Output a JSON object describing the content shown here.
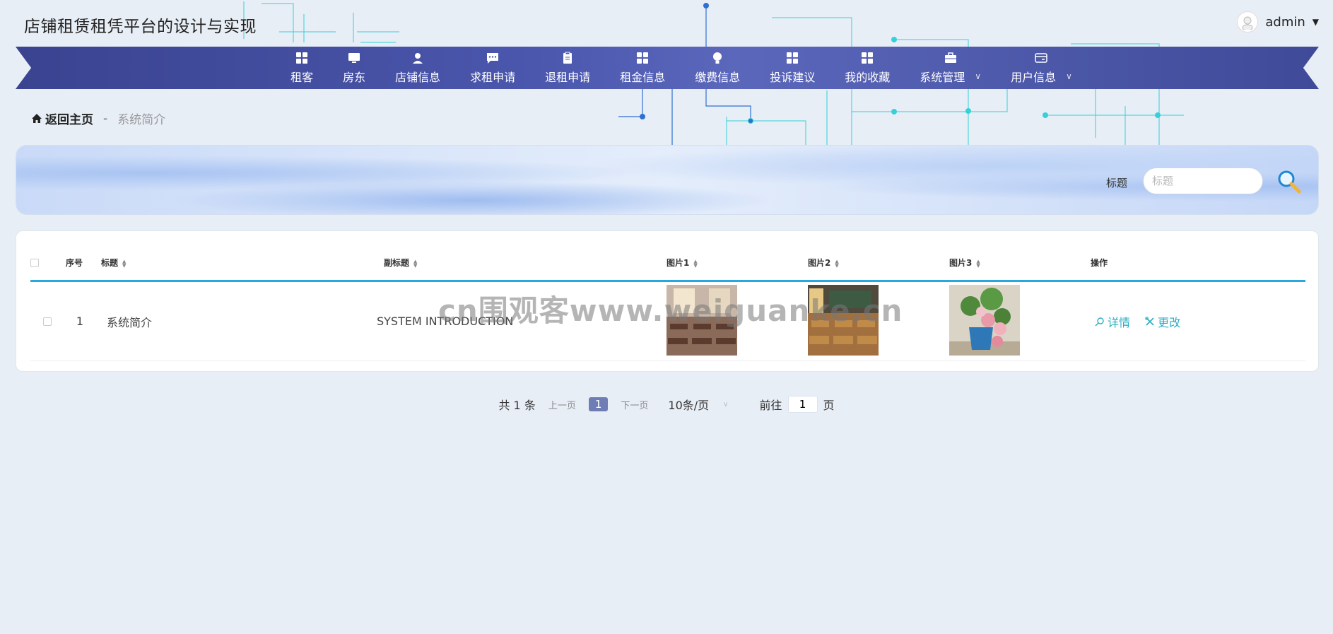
{
  "app": {
    "title": "店铺租赁租凭平台的设计与实现"
  },
  "user": {
    "name": "admin"
  },
  "nav": {
    "items": [
      {
        "label": "租客",
        "icon": "grid-icon"
      },
      {
        "label": "房东",
        "icon": "monitor-icon"
      },
      {
        "label": "店铺信息",
        "icon": "user-icon"
      },
      {
        "label": "求租申请",
        "icon": "chat-icon"
      },
      {
        "label": "退租申请",
        "icon": "clipboard-icon"
      },
      {
        "label": "租金信息",
        "icon": "grid-icon"
      },
      {
        "label": "缴费信息",
        "icon": "bulb-icon"
      },
      {
        "label": "投诉建议",
        "icon": "grid-icon"
      },
      {
        "label": "我的收藏",
        "icon": "grid-icon"
      },
      {
        "label": "系统管理",
        "icon": "briefcase-icon",
        "dropdown": true
      },
      {
        "label": "用户信息",
        "icon": "card-icon",
        "dropdown": true
      }
    ]
  },
  "breadcrumb": {
    "home": "返回主页",
    "separator": "-",
    "current": "系统简介"
  },
  "search": {
    "label": "标题",
    "placeholder": "标题",
    "value": ""
  },
  "table": {
    "headers": {
      "index": "序号",
      "title": "标题",
      "subtitle": "副标题",
      "img1": "图片1",
      "img2": "图片2",
      "img3": "图片3",
      "ops": "操作"
    },
    "rows": [
      {
        "index": "1",
        "title": "系统简介",
        "subtitle": "SYSTEM INTRODUCTION",
        "detail": "详情",
        "edit": "更改"
      }
    ]
  },
  "pagination": {
    "total": "共 1 条",
    "prev": "上一页",
    "current": "1",
    "next": "下一页",
    "page_size": "10条/页",
    "goto_label": "前往",
    "goto_value": "1",
    "goto_suffix": "页"
  },
  "watermark": "cn围观客www.weiguanke.cn",
  "colors": {
    "nav": "#4b57ad",
    "accent": "#28a8de",
    "op_link": "#2aaec4",
    "page_active": "#6f7db5"
  }
}
